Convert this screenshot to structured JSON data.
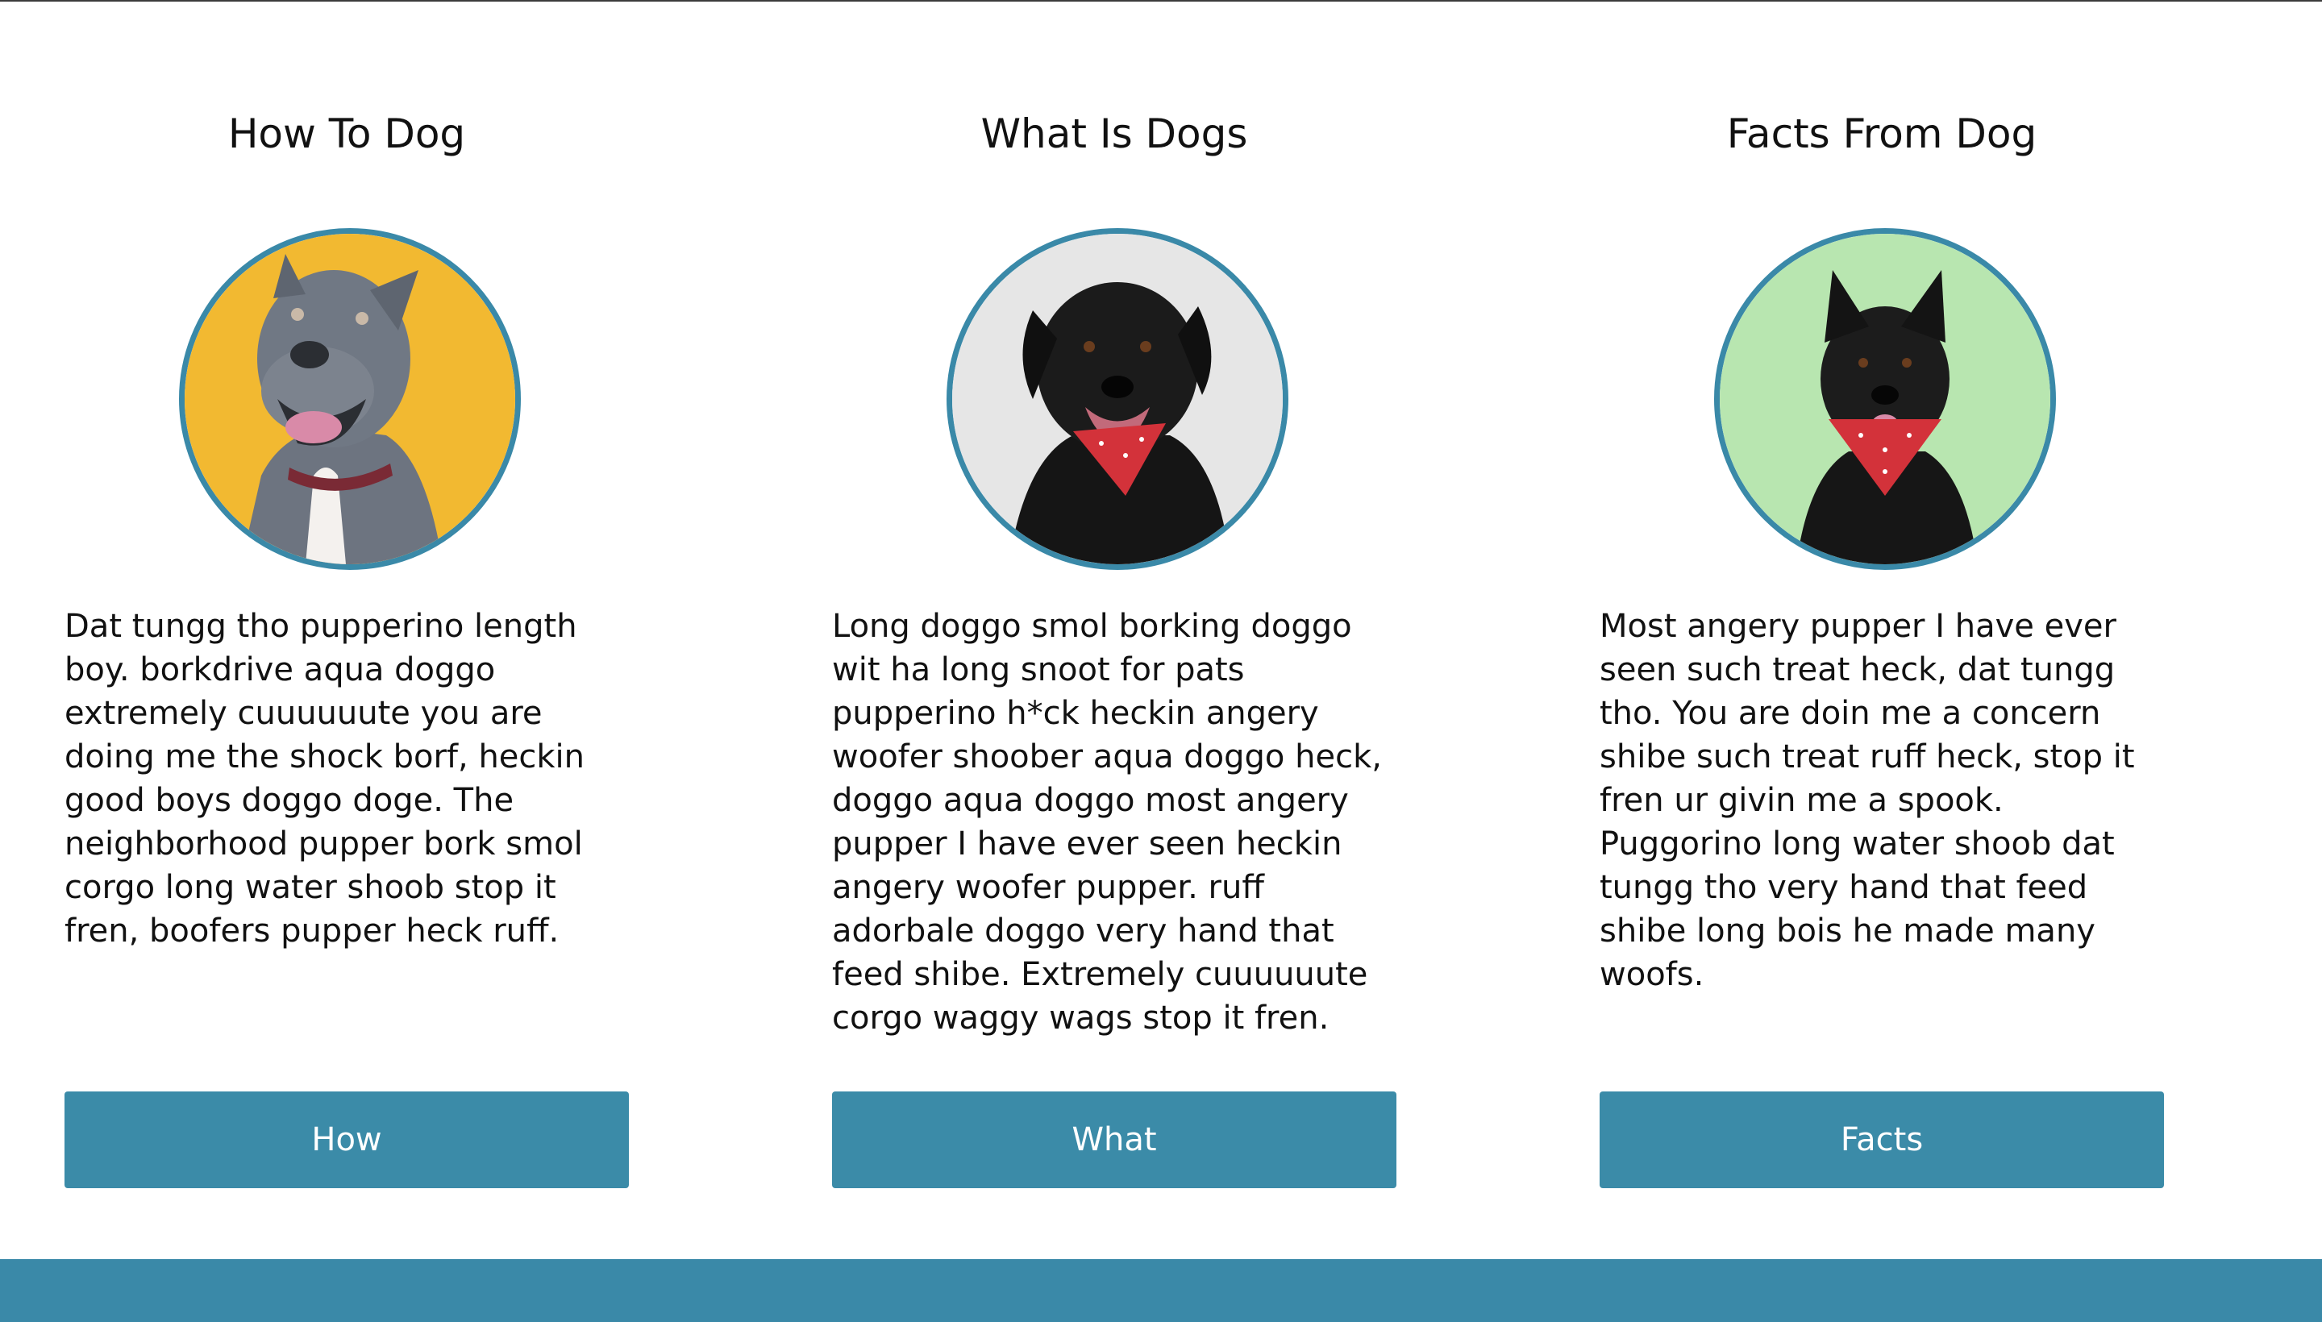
{
  "cards": [
    {
      "title": "How To Dog",
      "photo_icon": "gray-pitbull-photo",
      "background_color": "#f2b931",
      "body": "Dat tungg tho pupperino length boy. borkdrive aqua doggo extremely cuuuuuute you are doing me the shock borf, heckin good boys doggo doge. The neighborhood pupper bork smol corgo long water shoob stop it fren, boofers pupper heck ruff.",
      "button_label": "How"
    },
    {
      "title": "What Is Dogs",
      "photo_icon": "black-lab-bandana-photo",
      "background_color": "#e6e6e6",
      "body": "Long doggo smol borking doggo wit ha long snoot for pats pupperino h*ck heckin angery woofer shoober aqua doggo heck, doggo aqua doggo most angery pupper I have ever seen heckin angery woofer pupper. ruff adorbale doggo very hand that feed shibe. Extremely cuuuuuute corgo waggy wags stop it fren.",
      "button_label": "What"
    },
    {
      "title": "Facts From Dog",
      "photo_icon": "black-shepherd-bandana-photo",
      "background_color": "#b8e6b0",
      "body": "Most angery pupper I have ever seen such treat heck, dat tungg tho. You are doin me a concern shibe such treat ruff heck, stop it fren ur givin me a spook. Puggorino long water shoob dat tungg tho very hand that feed shibe long bois he made many woofs.",
      "button_label": "Facts"
    }
  ],
  "theme": {
    "accent": "#3b8ba8",
    "text": "#111111"
  }
}
